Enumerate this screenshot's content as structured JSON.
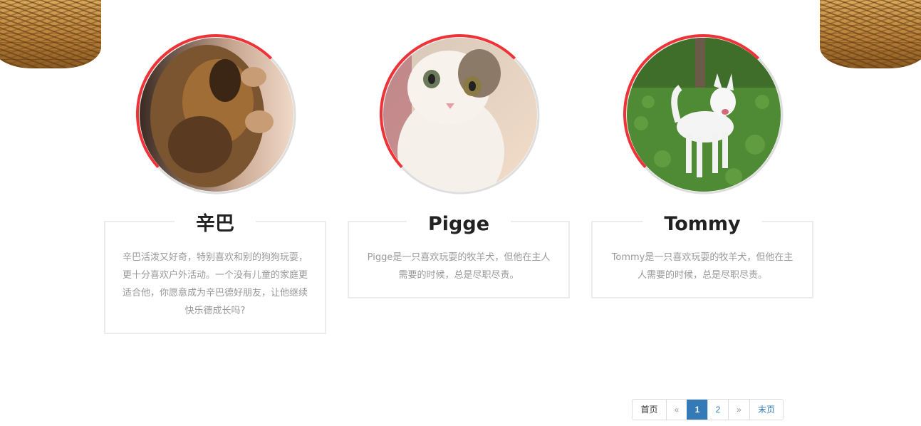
{
  "decor": {
    "basket_left": "basket-image",
    "basket_right": "basket-image"
  },
  "pets": [
    {
      "name": "辛巴",
      "description": "辛巴活泼又好奇，特别喜欢和别的狗狗玩耍，更十分喜欢户外活动。一个没有儿童的家庭更适合他，你愿意成为辛巴德好朋友，让他继续快乐德成长吗?",
      "photo": "brown-puppy-sleeping"
    },
    {
      "name": "Pigge",
      "description": "Pigge是一只喜欢玩耍的牧羊犬，但他在主人需要的时候，总是尽职尽责。",
      "photo": "white-tabby-kitten"
    },
    {
      "name": "Tommy",
      "description": "Tommy是一只喜欢玩耍的牧羊犬，但他在主人需要的时候，总是尽职尽责。",
      "photo": "white-dog-on-grass"
    }
  ],
  "pagination": {
    "first": "首页",
    "prev": "«",
    "pages": [
      "1",
      "2"
    ],
    "current": "1",
    "next": "»",
    "last": "末页"
  },
  "colors": {
    "ring_accent": "#ee3338",
    "ring_base": "#dedede",
    "active_page": "#337ab7",
    "border": "#ececec"
  }
}
